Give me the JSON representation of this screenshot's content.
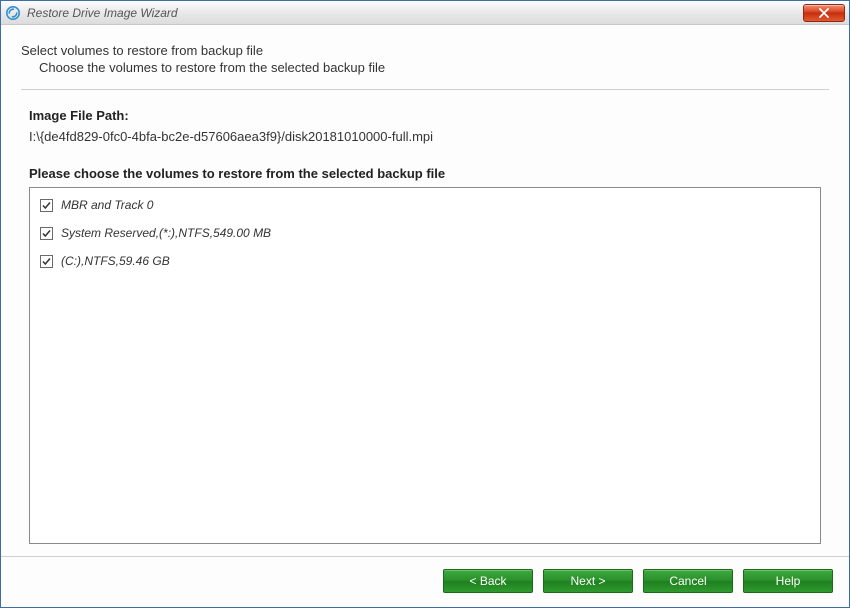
{
  "titlebar": {
    "title": "Restore Drive Image Wizard"
  },
  "intro": {
    "line1": "Select volumes to restore from backup file",
    "line2": "Choose the volumes to restore from the selected backup file"
  },
  "image_file": {
    "label": "Image File Path:",
    "path": "I:\\{de4fd829-0fc0-4bfa-bc2e-d57606aea3f9}/disk20181010000-full.mpi"
  },
  "choose_label": "Please choose the volumes to restore from the selected backup file",
  "volumes": [
    {
      "checked": true,
      "label": "MBR and Track 0"
    },
    {
      "checked": true,
      "label": "System Reserved,(*:),NTFS,549.00 MB"
    },
    {
      "checked": true,
      "label": "(C:),NTFS,59.46 GB"
    }
  ],
  "buttons": {
    "back": "< Back",
    "next": "Next >",
    "cancel": "Cancel",
    "help": "Help"
  }
}
